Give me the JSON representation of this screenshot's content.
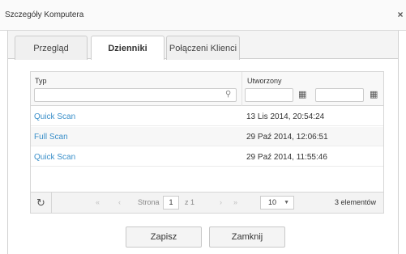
{
  "window": {
    "title": "Szczegóły Komputera",
    "close_glyph": "×"
  },
  "tabs": [
    {
      "label": "Przegląd",
      "active": false
    },
    {
      "label": "Dzienniki",
      "active": true
    },
    {
      "label": "Połączeni Klienci",
      "active": false
    }
  ],
  "grid": {
    "columns": {
      "type": "Typ",
      "created": "Utworzony"
    },
    "filters": {
      "type_value": "",
      "date_from": "",
      "date_to": ""
    },
    "rows": [
      {
        "type": "Quick Scan",
        "created": "13 Lis 2014, 20:54:24"
      },
      {
        "type": "Full Scan",
        "created": "29 Paź 2014, 12:06:51"
      },
      {
        "type": "Quick Scan",
        "created": "29 Paź 2014, 11:55:46"
      }
    ],
    "pager": {
      "page_label": "Strona",
      "page": "1",
      "of_label": "z 1",
      "page_size": "10",
      "count_label": "3 elementów"
    }
  },
  "buttons": {
    "save": "Zapisz",
    "close": "Zamknij"
  },
  "colors": {
    "link": "#3a8fc9",
    "border": "#d6d6d6"
  },
  "icons": [
    "close-icon",
    "search-icon",
    "calendar-icon",
    "refresh-icon",
    "first-page-icon",
    "prev-page-icon",
    "next-page-icon",
    "last-page-icon",
    "caret-down-icon"
  ]
}
